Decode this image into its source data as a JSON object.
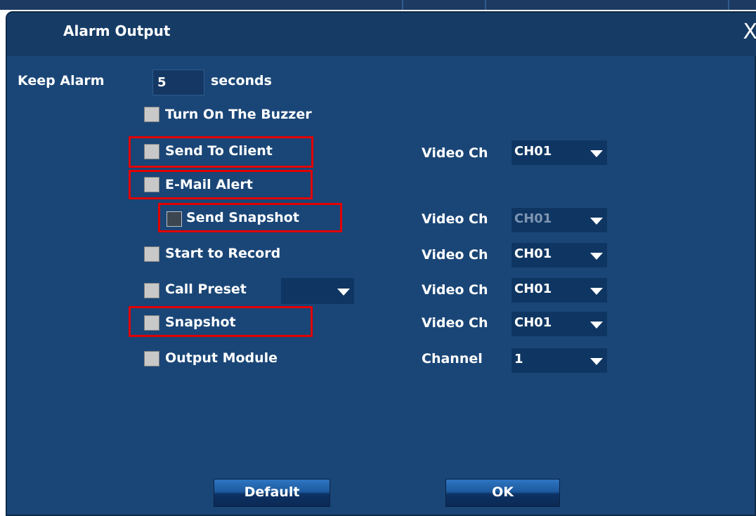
{
  "dialog": {
    "title": "Alarm Output",
    "close_label": "X"
  },
  "keep_alarm": {
    "label": "Keep Alarm",
    "value": "5",
    "unit": "seconds"
  },
  "options": [
    {
      "label": "Turn On The Buzzer",
      "checked": false,
      "highlighted": false
    },
    {
      "label": "Send To Client",
      "checked": false,
      "highlighted": true,
      "channel_label": "Video Ch",
      "channel_value": "CH01"
    },
    {
      "label": "E-Mail Alert",
      "checked": false,
      "highlighted": true
    },
    {
      "label": "Send Snapshot",
      "checked": false,
      "highlighted": true,
      "disabled": true,
      "channel_label": "Video Ch",
      "channel_value": "CH01"
    },
    {
      "label": "Start to Record",
      "checked": false,
      "highlighted": false,
      "channel_label": "Video Ch",
      "channel_value": "CH01"
    },
    {
      "label": "Call Preset",
      "checked": false,
      "highlighted": false,
      "preset_value": "",
      "channel_label": "Video Ch",
      "channel_value": "CH01"
    },
    {
      "label": "Snapshot",
      "checked": false,
      "highlighted": true,
      "channel_label": "Video Ch",
      "channel_value": "CH01"
    },
    {
      "label": "Output Module",
      "checked": false,
      "highlighted": false,
      "channel_label": "Channel",
      "channel_value": "1"
    }
  ],
  "buttons": {
    "default_label": "Default",
    "ok_label": "OK"
  },
  "colors": {
    "dialog_bg": "#1a4677",
    "highlight": "#e10000",
    "select_bg": "#0f3662"
  }
}
